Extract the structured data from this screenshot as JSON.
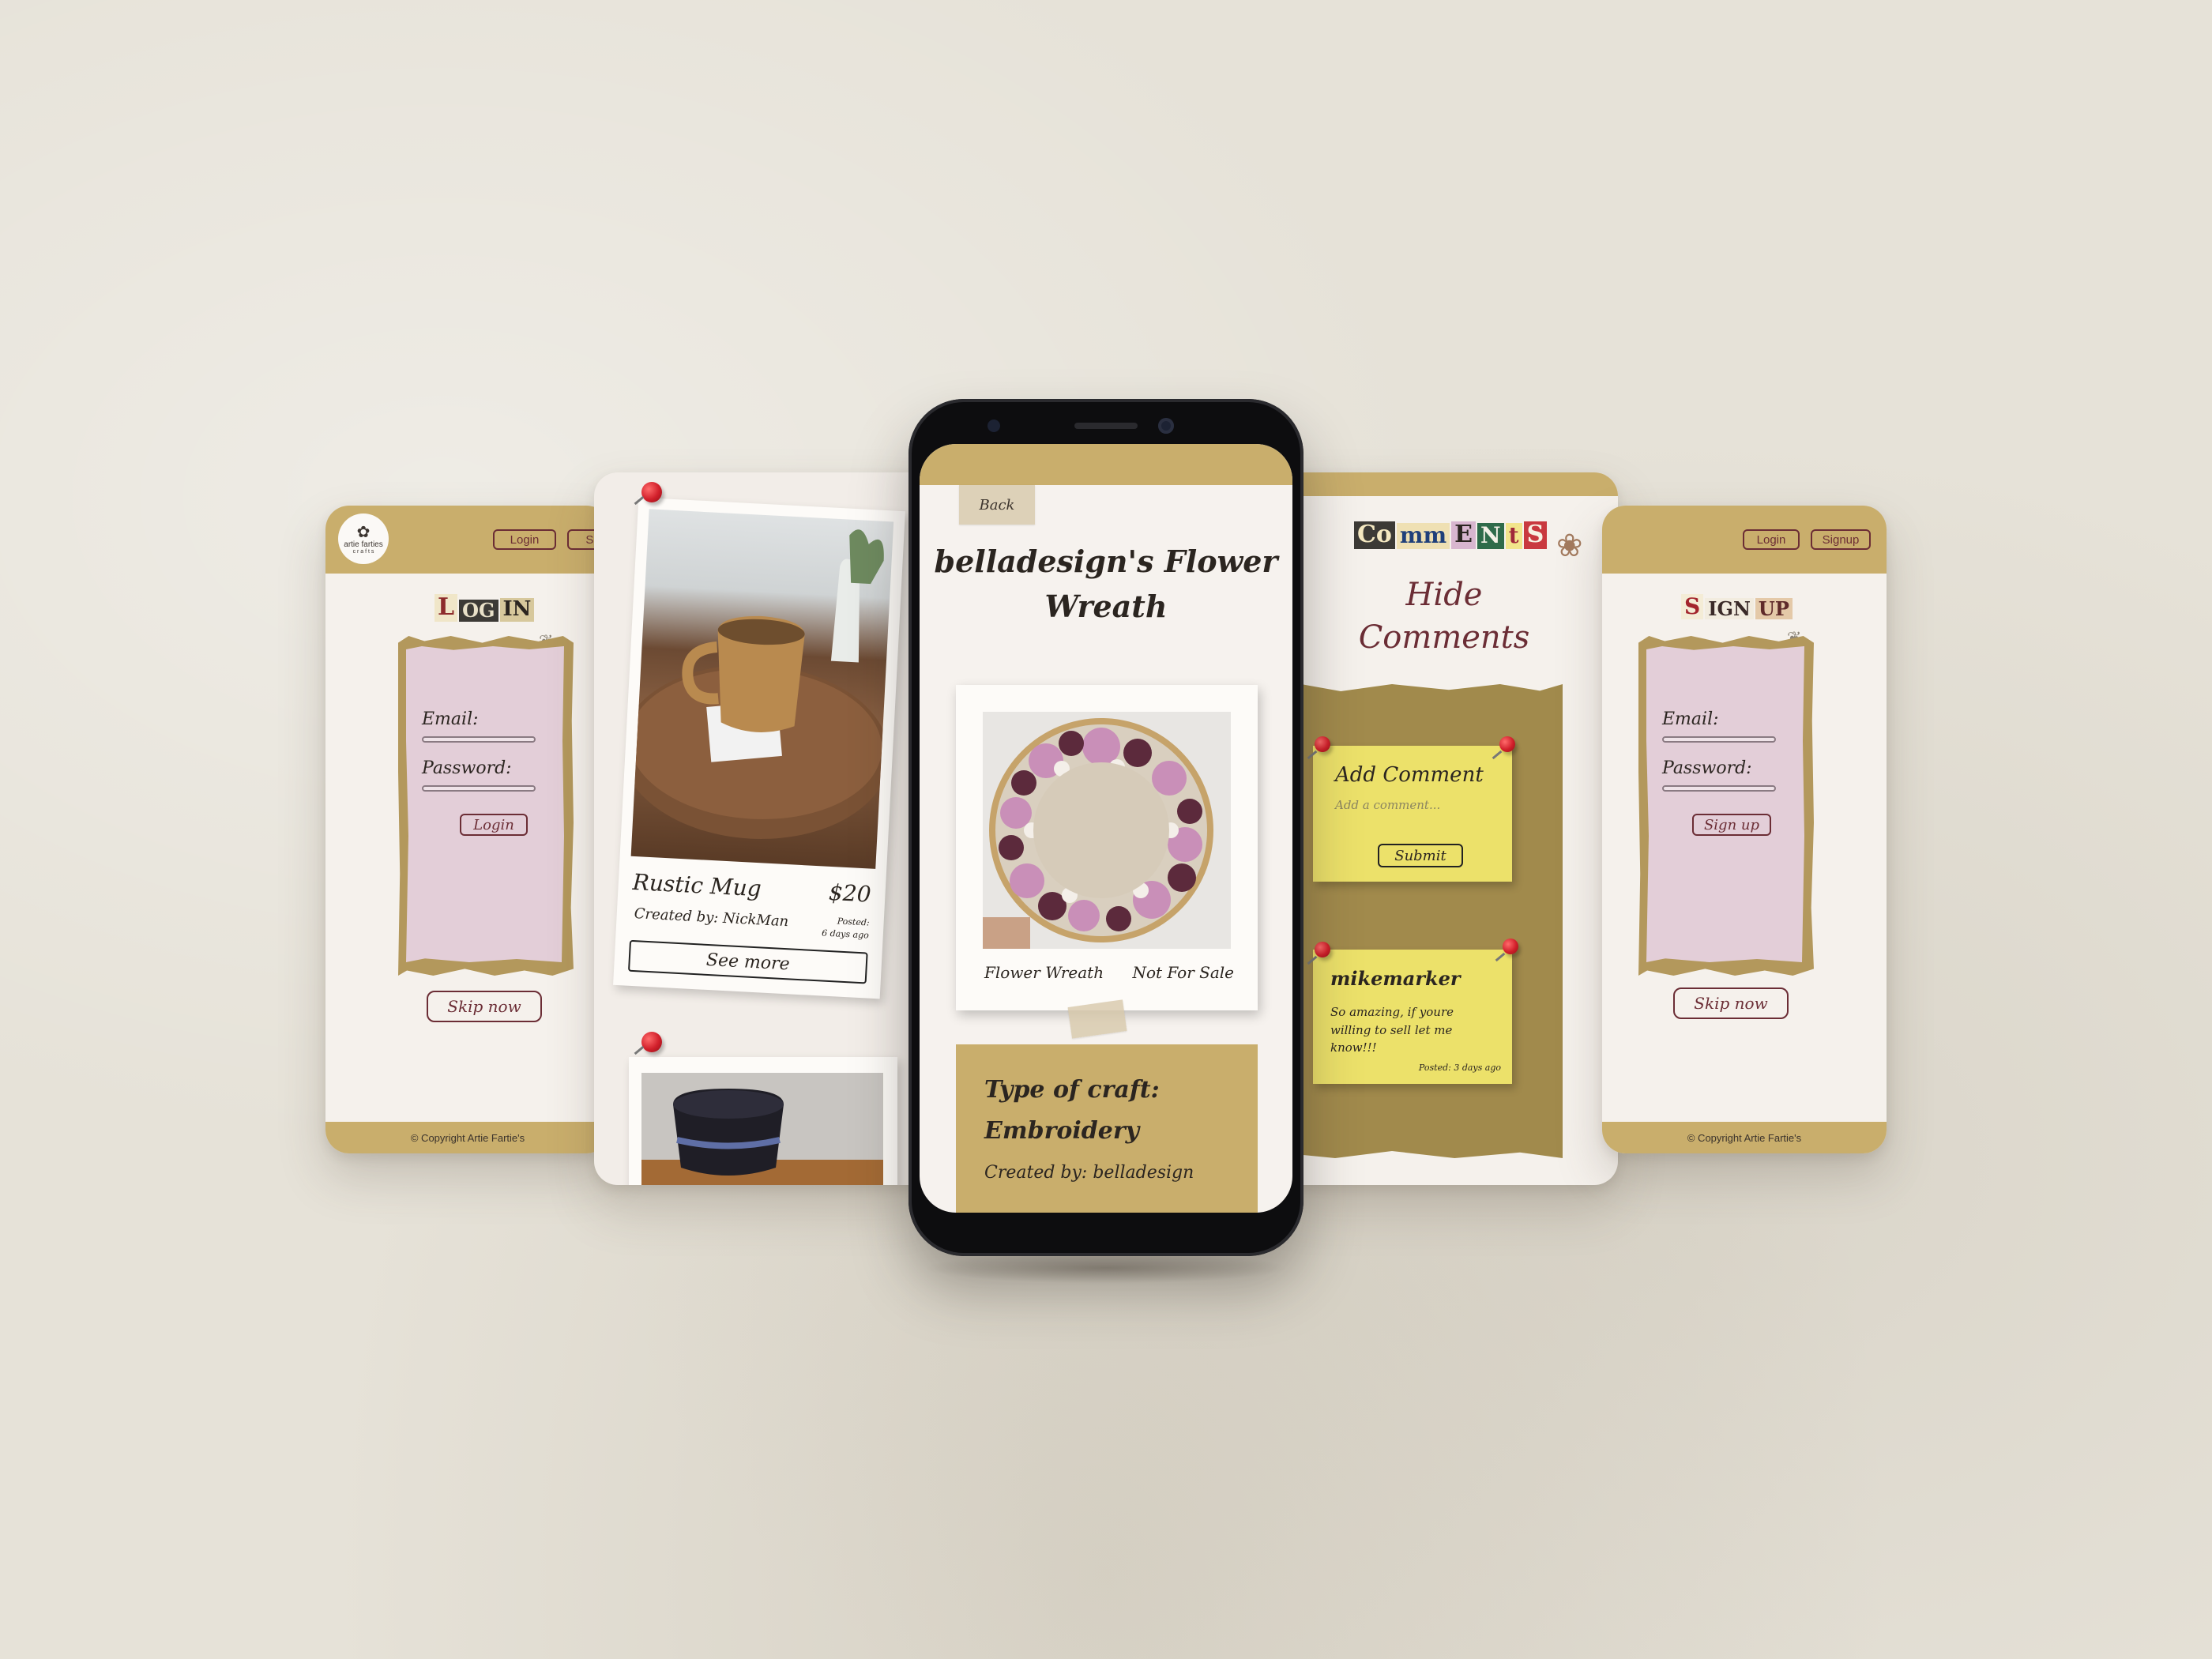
{
  "login_screen": {
    "logo_text": "artie farties",
    "logo_sub": "c r a f t s",
    "nav": [
      "Login",
      "Si"
    ],
    "title_letters": [
      "L",
      "OG",
      "IN"
    ],
    "email_label": "Email:",
    "password_label": "Password:",
    "submit_label": "Login",
    "skip_label": "Skip now",
    "footer": "© Copyright Artie Fartie's"
  },
  "listing_screen": {
    "item_name": "Rustic Mug",
    "price": "$20",
    "created_by": "Created by: NickMan",
    "posted_label": "Posted:",
    "posted_value": "6 days ago",
    "see_more": "See more"
  },
  "detail_screen": {
    "back_label": "Back",
    "title_line1": "belladesign's Flower",
    "title_line2": "Wreath",
    "image_caption": "Flower Wreath",
    "sale_status": "Not For Sale",
    "craft_type_label": "Type of craft:",
    "craft_type_value": "Embroidery",
    "created_by": "Created by: belladesign"
  },
  "comments_screen": {
    "title_letters": [
      "Co",
      "mm",
      "E",
      "N",
      "t",
      "S"
    ],
    "hide_line1": "Hide",
    "hide_line2": "Comments",
    "add_title": "Add Comment",
    "add_placeholder": "Add a comment...",
    "submit_label": "Submit",
    "comment_user": "mikemarker",
    "comment_text": "So amazing, if youre willing to sell let me know!!!",
    "comment_posted": "Posted: 3 days ago"
  },
  "signup_screen": {
    "nav": [
      "Login",
      "Signup"
    ],
    "title_letters": [
      "S",
      "IGN",
      "UP"
    ],
    "email_label": "Email:",
    "password_label": "Password:",
    "submit_label": "Sign up",
    "skip_label": "Skip now",
    "footer": "© Copyright Artie Fartie's"
  },
  "colors": {
    "background": "#e6e2d8",
    "gold": "#c9ae6c",
    "olive": "#a18a4c",
    "maroon": "#6b2d35",
    "pink_card": "#e3ced8",
    "sticky_yellow": "#ece16a",
    "pin_red": "#d11f2a"
  }
}
